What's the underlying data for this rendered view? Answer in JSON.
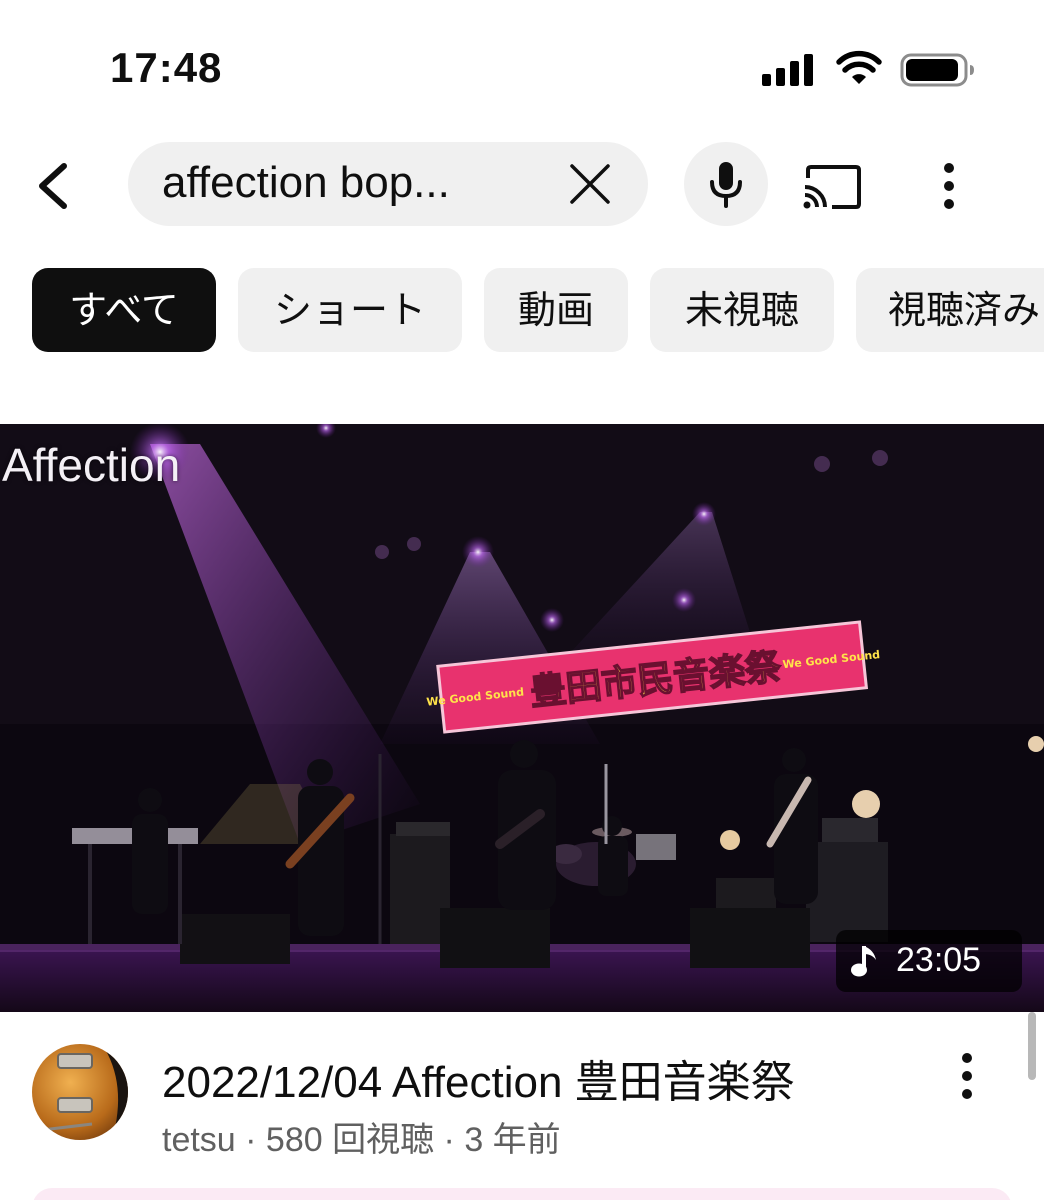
{
  "status_bar": {
    "time": "17:48"
  },
  "search": {
    "query": "affection bop..."
  },
  "chips": [
    {
      "label": "すべて",
      "active": true
    },
    {
      "label": "ショート",
      "active": false
    },
    {
      "label": "動画",
      "active": false
    },
    {
      "label": "未視聴",
      "active": false
    },
    {
      "label": "視聴済み",
      "active": false
    }
  ],
  "video": {
    "thumbnail_text": "Affection",
    "banner_text": "豊田市民音楽祭",
    "banner_side_text": "We Good Sound",
    "duration": "23:05",
    "title": "2022/12/04 Affection 豊田音楽祭",
    "channel": "tetsu",
    "views": "580 回視聴",
    "age": "3 年前",
    "subtitle": "tetsu · 580 回視聴 · 3 年前"
  },
  "icons": {
    "back": "chevron-left-icon",
    "clear": "close-icon",
    "mic": "microphone-icon",
    "cast": "cast-icon",
    "more": "more-vertical-icon",
    "music": "music-note-icon"
  },
  "colors": {
    "chip_active_bg": "#0f0f0f",
    "chip_bg": "#f0f0f0",
    "banner_bg": "#e0306a",
    "stage_light": "#b84cff"
  }
}
